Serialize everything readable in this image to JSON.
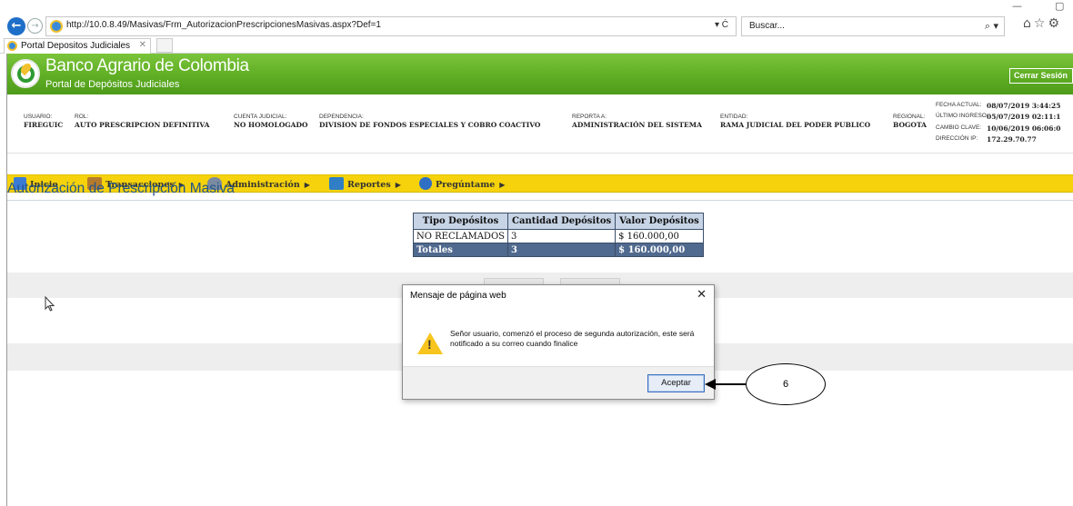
{
  "browser": {
    "url": "http://10.0.8.49/Masivas/Frm_AutorizacionPrescripcionesMasivas.aspx?Def=1",
    "url_controls": "▾ Ċ",
    "search_placeholder": "Buscar...",
    "search_controls": "⌕ ▾",
    "tab_title": "Portal Depositos Judiciales",
    "toolbar_icons": "⌂☆⚙",
    "minimize": "—",
    "maximize": "▢"
  },
  "header": {
    "bank_name": "Banco Agrario de Colombia",
    "portal_name": "Portal de Depósitos Judiciales",
    "logout": "Cerrar Sesión"
  },
  "user_info": {
    "usuario_label": "USUARIO:",
    "usuario": "FIREGUIC",
    "rol_label": "ROL:",
    "rol": "AUTO PRESCRIPCION DEFINITIVA",
    "cuenta_label": "CUENTA JUDICIAL:",
    "cuenta": "NO HOMOLOGADO",
    "dependencia_label": "DEPENDENCIA:",
    "dependencia": "DIVISION DE FONDOS ESPECIALES Y COBRO COACTIVO",
    "reporta_label": "REPORTA A:",
    "reporta": "ADMINISTRACIÓN DEL SISTEMA",
    "entidad_label": "ENTIDAD:",
    "entidad": "RAMA JUDICIAL DEL PODER PUBLICO",
    "regional_label": "REGIONAL:",
    "regional": "BOGOTA",
    "fecha_actual_label": "FECHA ACTUAL:",
    "fecha_actual": "08/07/2019 3:44:25",
    "ultimo_ingreso_label": "ÚLTIMO INGRESO:",
    "ultimo_ingreso": "05/07/2019 02:11:1",
    "cambio_clave_label": "CAMBIO CLAVE:",
    "cambio_clave": "10/06/2019 06:06:0",
    "direccion_ip_label": "DIRECCIÓN IP:",
    "direccion_ip": "172.29.70.77"
  },
  "menu": {
    "inicio": "Inicio",
    "transacciones": "Transacciones",
    "administracion": "Administración",
    "reportes": "Reportes",
    "preguntame": "Pregúntame",
    "submenu_arrow": "▶"
  },
  "page": {
    "title": "Autorización de Prescripción Masiva"
  },
  "table": {
    "headers": [
      "Tipo Depósitos",
      "Cantidad Depósitos",
      "Valor Depósitos"
    ],
    "rows": [
      [
        "NO RECLAMADOS",
        "3",
        "$ 160.000,00"
      ]
    ],
    "totals": [
      "Totales",
      "3",
      "$ 160.000,00"
    ]
  },
  "dialog": {
    "title": "Mensaje de página web",
    "close": "✕",
    "warning_mark": "!",
    "message": "Señor usuario, comenzó el proceso de segunda autorización, este será notificado a su correo cuando finalice",
    "ok_label": "Aceptar"
  },
  "annotation": {
    "number": "6"
  },
  "colors": {
    "header_green": "#5fae24",
    "menu_yellow": "#f5d20b",
    "title_blue": "#21558c",
    "table_header": "#c7d4e6",
    "totals_row": "#50698e"
  }
}
